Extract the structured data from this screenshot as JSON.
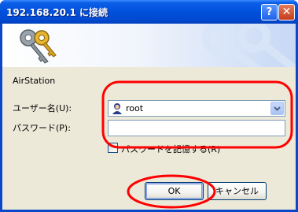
{
  "window": {
    "title": "192.168.20.1 に接続",
    "help_symbol": "?",
    "close_symbol": "✕"
  },
  "banner": {
    "icon": "keys-icon"
  },
  "form": {
    "realm": "AirStation",
    "username_label": "ユーザー名(U):",
    "username_value": "root",
    "password_label": "パスワード(P):",
    "password_value": "",
    "remember_label": "パスワードを記憶する(R)",
    "remember_checked": false
  },
  "buttons": {
    "ok": "OK",
    "cancel": "キャンセル"
  },
  "colors": {
    "titlebar": "#0151dc",
    "dialog_bg": "#ece9d8",
    "annotation": "#ff0000"
  }
}
